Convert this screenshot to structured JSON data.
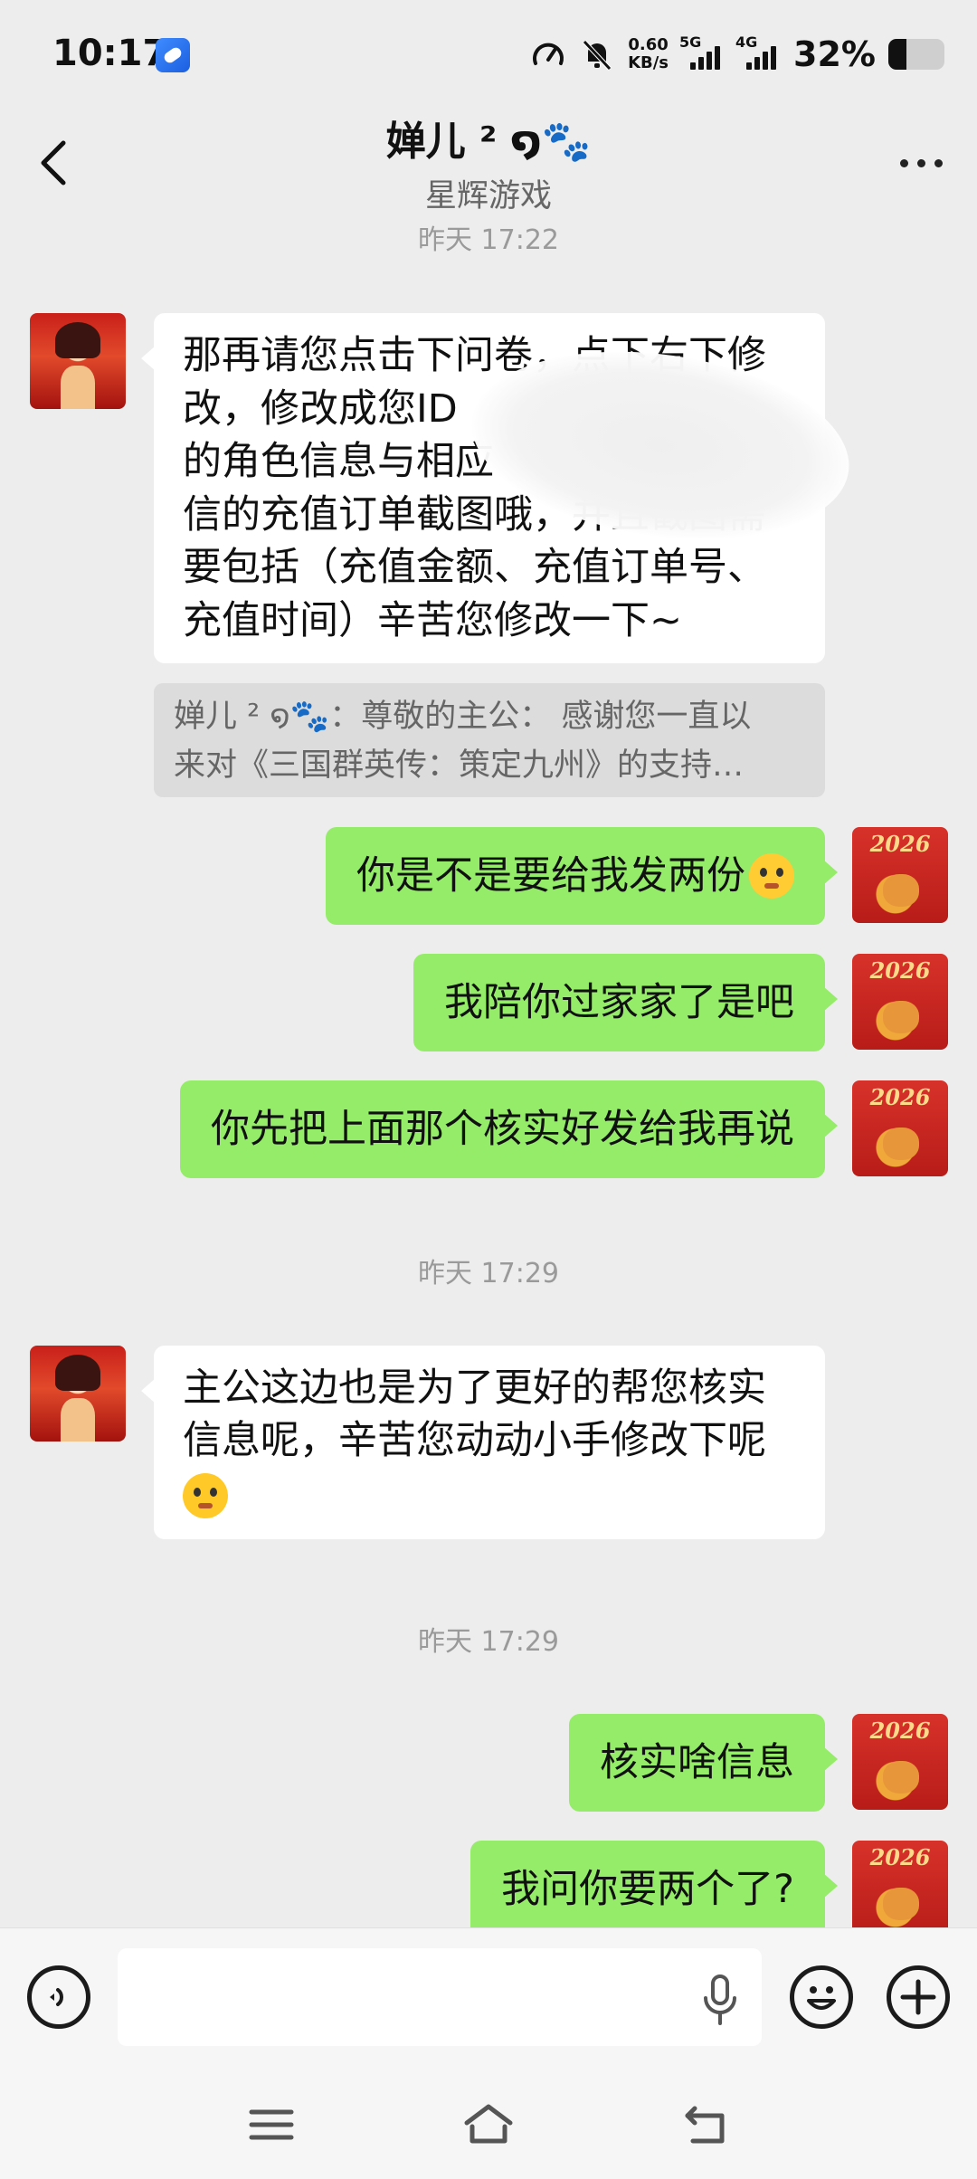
{
  "status_bar": {
    "time": "10:17",
    "net_speed_value": "0.60",
    "net_speed_unit": "KB/s",
    "sim1_label": "5G",
    "sim2_label": "4G",
    "battery_percent": "32%",
    "battery_level": 0.32,
    "icons": [
      "app-notification-icon",
      "speedometer-icon",
      "bell-muted-icon",
      "signal-icon",
      "battery-icon"
    ]
  },
  "header": {
    "title": "婵儿 ² ໑🐾",
    "subtitle": "星辉游戏",
    "back_icon": "chevron-left-icon",
    "more_icon": "more-dots-icon"
  },
  "messages": [
    {
      "type": "time",
      "text": "昨天 17:22"
    },
    {
      "type": "text",
      "side": "left",
      "text": "那再请您点击下问卷，点下右下修改，修改成您ID 的角色信息与相应 信的充值订单截图哦，并且截图需要包括（充值金额、充值订单号、充值时间）辛苦您修改一下~"
    },
    {
      "type": "quote",
      "line1": "婵儿 ² ໑🐾：尊敬的主公： 感谢您一直以",
      "line2": "来对《三国群英传：策定九州》的支持…"
    },
    {
      "type": "text",
      "side": "right",
      "text": "你是不是要给我发两份",
      "emoji": "doge-emoji"
    },
    {
      "type": "text",
      "side": "right",
      "text": "我陪你过家家了是吧"
    },
    {
      "type": "text",
      "side": "right",
      "text": "你先把上面那个核实好发给我再说"
    },
    {
      "type": "time",
      "text": "昨天 17:29"
    },
    {
      "type": "text",
      "side": "left",
      "line1": "主公这边也是为了更好的帮您核实",
      "line2": "信息呢，辛苦您动动小手修改下呢",
      "emoji": "pleading-emoji"
    },
    {
      "type": "time",
      "text": "昨天 17:29"
    },
    {
      "type": "text",
      "side": "right",
      "text": "核实啥信息"
    },
    {
      "type": "text",
      "side": "right",
      "text": "我问你要两个了?"
    }
  ],
  "first_message_lines": [
    "那再请您点击下问卷，点下右下修",
    "改，修改成您ID",
    "的角色信息与相应",
    "信的充值订单截图哦，并且截图需",
    "要包括（充值金额、充值订单号、",
    "充值时间）辛苦您修改一下~"
  ],
  "avatar_me_text": "2026",
  "composer": {
    "input_value": "",
    "icons": [
      "voice-icon",
      "mic-icon",
      "emoji-icon",
      "plus-icon"
    ]
  },
  "navbar": {
    "icons": [
      "menu-icon",
      "home-icon",
      "back-icon"
    ]
  }
}
